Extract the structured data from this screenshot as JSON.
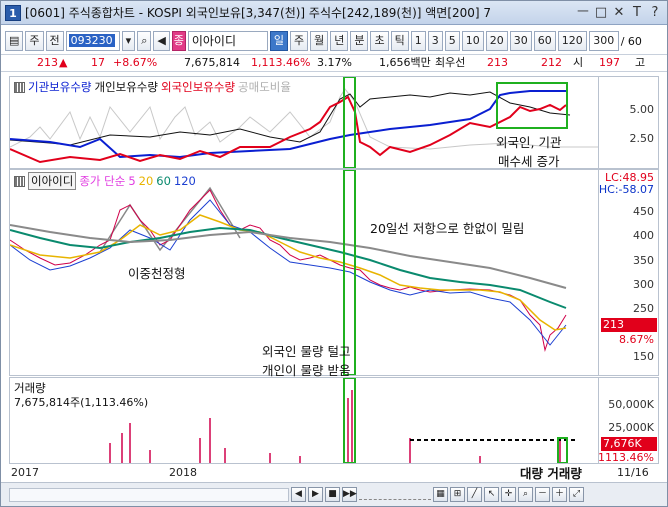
{
  "window": {
    "title": "[0601] 주식종합차트 - KOSPI 외국인보유[3,347(천)] 주식수[242,189(천)] 액면[200] 7",
    "app_icon": "1",
    "buttons": [
      "ㅡ",
      "□",
      "✕",
      "T",
      "?"
    ]
  },
  "toolbar": {
    "rows_toggle": "▤",
    "period_select": "주",
    "compare": "전",
    "code": "093230",
    "name": "이아이디",
    "period_tabs": [
      "일",
      "주",
      "월",
      "년",
      "분",
      "초",
      "틱"
    ],
    "minute_tabs": [
      "1",
      "3",
      "5",
      "10",
      "20",
      "30",
      "60",
      "120"
    ],
    "count_value": "300",
    "count_unit": "/ 60"
  },
  "quote": {
    "price": "213",
    "arrow": "▲",
    "change": "17",
    "change_pct": "+8.67%",
    "volume": "7,675,814",
    "vol_ratio": "1,113.46%",
    "turnover": "3.17%",
    "amount": "1,656백만",
    "best_ask_label": "최우선",
    "best_ask": "213",
    "best_bid": "212",
    "open_label": "시",
    "open": "197",
    "high_label": "고"
  },
  "upper_panel": {
    "legend": [
      "기관보유수량",
      "개인보유수량",
      "외국인보유수량",
      "공매도비율"
    ],
    "legend_colors": [
      "#0a1fd1",
      "#111111",
      "#e1001b",
      "#b0b0b0"
    ],
    "y_ticks": [
      "5.00",
      "2.50"
    ],
    "annotation": [
      "외국인, 기관",
      "매수세 증가"
    ]
  },
  "price_panel": {
    "stock_tag": "이아이디",
    "ma_label": "종가 단순",
    "ma_periods": [
      "5",
      "20",
      "60",
      "120"
    ],
    "ma_colors": [
      "#e13ce1",
      "#e8b400",
      "#0a8a6e",
      "#1c3fd1"
    ],
    "lc_label": "LC:48.95",
    "hc_label": "HC:-58.07",
    "y_ticks": [
      "450",
      "400",
      "350",
      "300",
      "250",
      "200",
      "150"
    ],
    "current_price": "213",
    "current_pct": "8.67%",
    "annotation_top": "20일선 저항으로 한없이 밀림",
    "annotation_pattern": "이중천정형",
    "annotation_mid": [
      "외국인 물량 털고",
      "개인이 물량 받음"
    ]
  },
  "volume_panel": {
    "label": "거래량",
    "value_line": "7,675,814주(1,113.46%)",
    "y_ticks": [
      "50,000K",
      "25,000K"
    ],
    "current_vol": "7,676K",
    "current_pct": "1113.46%",
    "annotation": "대량 거래량"
  },
  "x_axis": {
    "labels": [
      "2017",
      "2018"
    ],
    "date": "11/16"
  },
  "bottom": {
    "nav": [
      "◀",
      "▶",
      "■",
      "▶▶"
    ],
    "zoom": [
      "－",
      "＋"
    ]
  }
}
